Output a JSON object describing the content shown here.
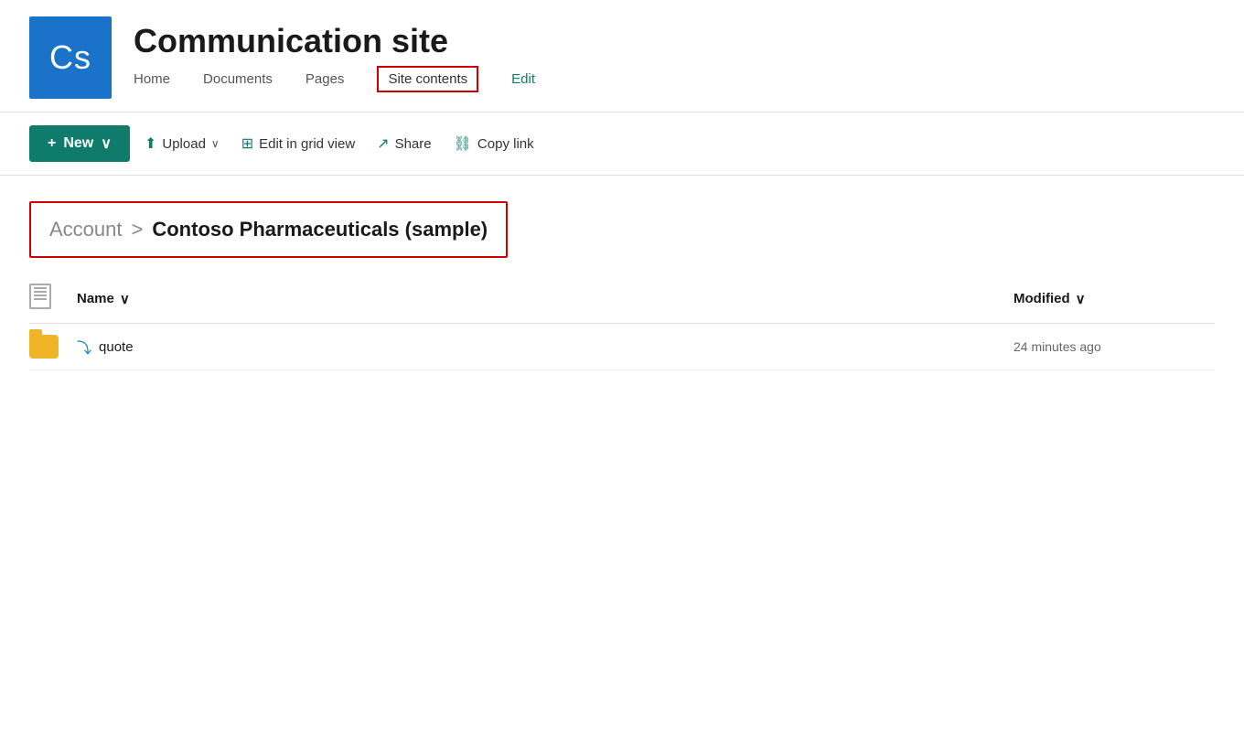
{
  "header": {
    "logo_text": "Cs",
    "site_title": "Communication site",
    "nav": [
      {
        "label": "Home",
        "id": "home",
        "active": false,
        "edit": false
      },
      {
        "label": "Documents",
        "id": "documents",
        "active": false,
        "edit": false
      },
      {
        "label": "Pages",
        "id": "pages",
        "active": false,
        "edit": false
      },
      {
        "label": "Site contents",
        "id": "site-contents",
        "active": true,
        "edit": false
      },
      {
        "label": "Edit",
        "id": "edit",
        "active": false,
        "edit": true
      }
    ]
  },
  "toolbar": {
    "new_label": "New",
    "upload_label": "Upload",
    "edit_grid_label": "Edit in grid view",
    "share_label": "Share",
    "copy_link_label": "Copy link"
  },
  "breadcrumb": {
    "account_label": "Account",
    "separator": ">",
    "current_label": "Contoso Pharmaceuticals (sample)"
  },
  "file_list": {
    "col_name": "Name",
    "col_modified": "Modified",
    "rows": [
      {
        "type": "folder",
        "name": "quote",
        "modified": "24 minutes ago",
        "syncing": true
      }
    ]
  },
  "icons": {
    "plus": "+",
    "chevron_down": "∨",
    "upload_arrow": "↑",
    "grid": "⊞",
    "share": "↗",
    "link": "⛓",
    "sort_down": "∨"
  }
}
